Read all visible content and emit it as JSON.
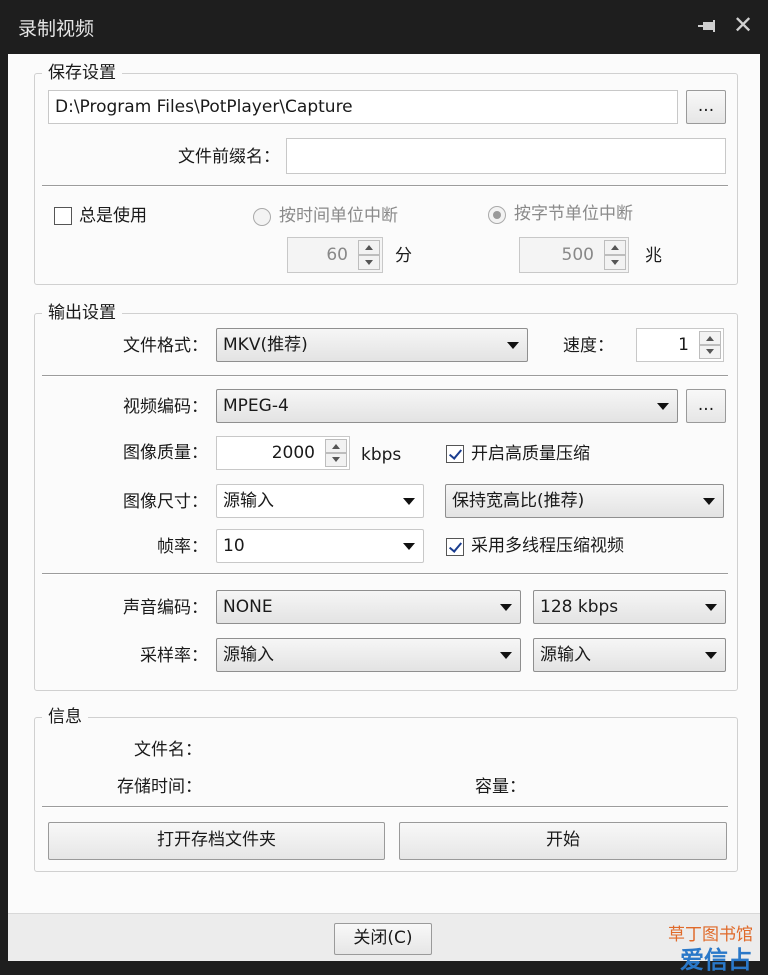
{
  "window": {
    "title": "录制视频"
  },
  "save_settings": {
    "legend": "保存设置",
    "path_value": "D:\\Program Files\\PotPlayer\\Capture",
    "browse_label": "...",
    "prefix_label": "文件前缀名：",
    "prefix_value": "",
    "always_use_label": "总是使用",
    "always_use_checked": false,
    "split_by_time_label": "按时间单位中断",
    "split_by_time_value": "60",
    "time_unit": "分",
    "split_by_size_label": "按字节单位中断",
    "split_by_size_value": "500",
    "size_unit": "兆"
  },
  "output_settings": {
    "legend": "输出设置",
    "format_label": "文件格式：",
    "format_value": "MKV(推荐)",
    "speed_label": "速度：",
    "speed_value": "1",
    "video_codec_label": "视频编码：",
    "video_codec_value": "MPEG-4",
    "browse_label": "...",
    "quality_label": "图像质量：",
    "quality_value": "2000",
    "quality_unit": "kbps",
    "hq_label": "开启高质量压缩",
    "hq_checked": true,
    "size_label": "图像尺寸：",
    "size_value": "源输入",
    "aspect_value": "保持宽高比(推荐)",
    "fps_label": "帧率：",
    "fps_value": "10",
    "multithread_label": "采用多线程压缩视频",
    "multithread_checked": true,
    "audio_codec_label": "声音编码：",
    "audio_codec_value": "NONE",
    "audio_bitrate_value": "128 kbps",
    "sample_rate_label": "采样率：",
    "sample_rate_value": "源输入",
    "channels_value": "源输入"
  },
  "info": {
    "legend": "信息",
    "filename_label": "文件名：",
    "duration_label": "存储时间：",
    "capacity_label": "容量：",
    "open_folder_label": "打开存档文件夹",
    "start_label": "开始"
  },
  "footer": {
    "close_label": "关闭(C)"
  },
  "watermark": {
    "line1": "草丁图书馆",
    "line2": "爱信占"
  }
}
